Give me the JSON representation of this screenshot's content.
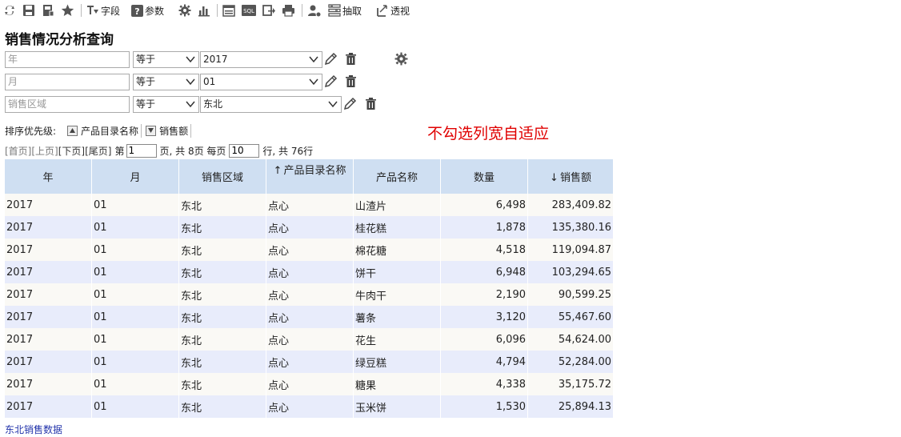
{
  "toolbar": {
    "field_label": "字段",
    "param_label": "参数",
    "extract_label": "抽取",
    "pivot_label": "透视",
    "sql_label": "SQL"
  },
  "page_title": "销售情况分析查询",
  "conditions": [
    {
      "field_placeholder": "年",
      "operator": "等于",
      "value": "2017"
    },
    {
      "field_placeholder": "月",
      "operator": "等于",
      "value": "01"
    },
    {
      "field_placeholder": "销售区域",
      "operator": "等于",
      "value": "东北"
    }
  ],
  "sort": {
    "label": "排序优先级:",
    "items": [
      "产品目录名称",
      "销售额"
    ]
  },
  "note": "不勾选列宽自适应",
  "pager": {
    "first": "[首页]",
    "prev": "[上页]",
    "next": "[下页]",
    "last": "[尾页]",
    "page_prefix": "第",
    "page_value": "1",
    "page_suffix": "页, 共 8页 每页",
    "rows_value": "10",
    "rows_suffix": "行, 共 76行"
  },
  "table": {
    "headers": [
      "年",
      "月",
      "销售区域",
      "产品目录名称",
      "产品名称",
      "数量",
      "销售额"
    ],
    "rows": [
      [
        "2017",
        "01",
        "东北",
        "点心",
        "山渣片",
        "6,498",
        "283,409.82"
      ],
      [
        "2017",
        "01",
        "东北",
        "点心",
        "桂花糕",
        "1,878",
        "135,380.16"
      ],
      [
        "2017",
        "01",
        "东北",
        "点心",
        "棉花糖",
        "4,518",
        "119,094.87"
      ],
      [
        "2017",
        "01",
        "东北",
        "点心",
        "饼干",
        "6,948",
        "103,294.65"
      ],
      [
        "2017",
        "01",
        "东北",
        "点心",
        "牛肉干",
        "2,190",
        "90,599.25"
      ],
      [
        "2017",
        "01",
        "东北",
        "点心",
        "薯条",
        "3,120",
        "55,467.60"
      ],
      [
        "2017",
        "01",
        "东北",
        "点心",
        "花生",
        "6,096",
        "54,624.00"
      ],
      [
        "2017",
        "01",
        "东北",
        "点心",
        "绿豆糕",
        "4,794",
        "52,284.00"
      ],
      [
        "2017",
        "01",
        "东北",
        "点心",
        "糖果",
        "4,338",
        "35,175.72"
      ],
      [
        "2017",
        "01",
        "东北",
        "点心",
        "玉米饼",
        "1,530",
        "25,894.13"
      ]
    ]
  },
  "footer_link": "东北销售数据"
}
